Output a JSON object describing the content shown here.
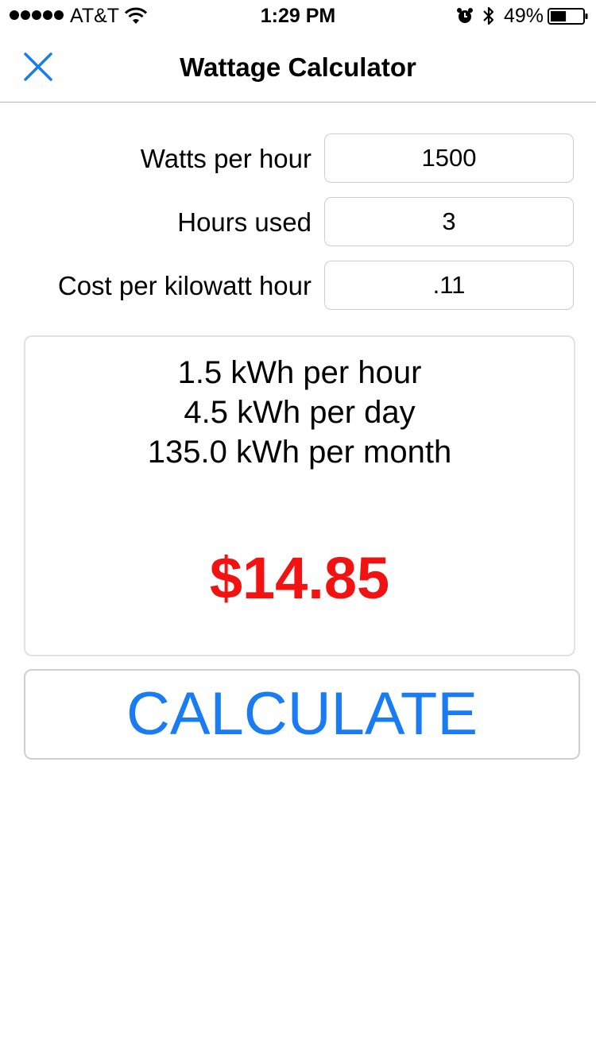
{
  "status_bar": {
    "carrier": "AT&T",
    "time": "1:29 PM",
    "battery_percent": "49%",
    "battery_level": 0.49,
    "icons": [
      "signal-dots",
      "wifi-icon",
      "alarm-icon",
      "bluetooth-icon",
      "battery-icon"
    ]
  },
  "nav": {
    "title": "Wattage Calculator",
    "close_icon": "close-icon",
    "accent_color": "#1a7cf4"
  },
  "form": {
    "watts": {
      "label": "Watts per hour",
      "value": "1500"
    },
    "hours": {
      "label": "Hours used",
      "value": "3"
    },
    "cost": {
      "label": "Cost per kilowatt hour",
      "value": ".11"
    }
  },
  "results": {
    "per_hour": "1.5 kWh per hour",
    "per_day": "4.5 kWh per day",
    "per_month": "135.0 kWh per month",
    "total": "$14.85",
    "total_color": "#f21212"
  },
  "actions": {
    "calculate_label": "CALCULATE"
  }
}
